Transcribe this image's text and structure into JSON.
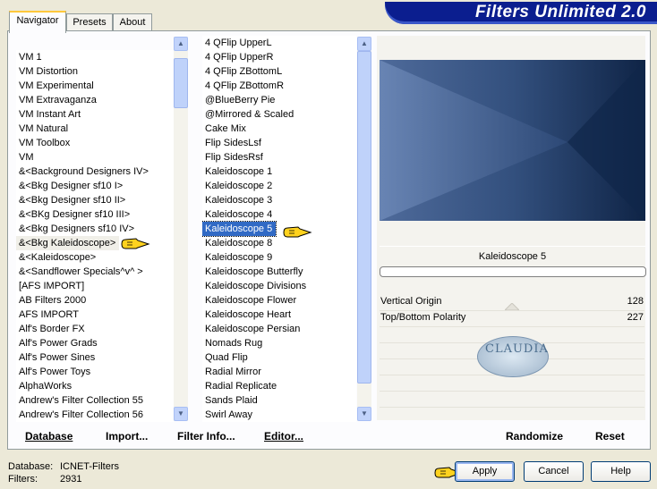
{
  "window": {
    "title": "Filters Unlimited 2.0"
  },
  "tabs": [
    {
      "label": "Navigator"
    },
    {
      "label": "Presets"
    },
    {
      "label": "About"
    }
  ],
  "categories": {
    "items": [
      "VM 1",
      "VM Distortion",
      "VM Experimental",
      "VM Extravaganza",
      "VM Instant Art",
      "VM Natural",
      "VM Toolbox",
      "VM",
      "&<Background Designers IV>",
      "&<Bkg Designer sf10 I>",
      "&<Bkg Designer sf10 II>",
      "&<BKg Designer sf10 III>",
      "&<Bkg Designers sf10 IV>",
      "&<Bkg Kaleidoscope>",
      "&<Kaleidoscope>",
      "&<Sandflower Specials^v^ >",
      "[AFS IMPORT]",
      "AB Filters 2000",
      "AFS IMPORT",
      "Alf's Border FX",
      "Alf's Power Grads",
      "Alf's Power Sines",
      "Alf's Power Toys",
      "AlphaWorks",
      "Andrew's Filter Collection 55",
      "Andrew's Filter Collection 56"
    ],
    "selected": "&<Bkg Kaleidoscope>"
  },
  "filters": {
    "items": [
      "4 QFlip UpperL",
      "4 QFlip UpperR",
      "4 QFlip ZBottomL",
      "4 QFlip ZBottomR",
      "@BlueBerry Pie",
      "@Mirrored & Scaled",
      "Cake Mix",
      "Flip SidesLsf",
      "Flip SidesRsf",
      "Kaleidoscope 1",
      "Kaleidoscope 2",
      "Kaleidoscope 3",
      "Kaleidoscope 4",
      "Kaleidoscope 5",
      "Kaleidoscope 8",
      "Kaleidoscope 9",
      "Kaleidoscope Butterfly",
      "Kaleidoscope Divisions",
      "Kaleidoscope Flower",
      "Kaleidoscope Heart",
      "Kaleidoscope Persian",
      "Nomads Rug",
      "Quad Flip",
      "Radial Mirror",
      "Radial Replicate",
      "Sands Plaid",
      "Swirl Away"
    ],
    "selected": "Kaleidoscope 5"
  },
  "preview": {
    "filter_name": "Kaleidoscope 5",
    "watermark": "CLAUDIA"
  },
  "parameters": [
    {
      "label": "Vertical Origin",
      "value": "128"
    },
    {
      "label": "Top/Bottom Polarity",
      "value": "227"
    }
  ],
  "bottom_links": {
    "database": "Database",
    "import": "Import...",
    "filter_info": "Filter Info...",
    "editor": "Editor...",
    "randomize": "Randomize",
    "reset": "Reset"
  },
  "status": {
    "database_label": "Database:",
    "database_value": "ICNET-Filters",
    "filters_label": "Filters:",
    "filters_value": "2931"
  },
  "buttons": {
    "apply": "Apply",
    "cancel": "Cancel",
    "help": "Help"
  },
  "colors": {
    "selection": "#316AC5",
    "banner": "#0B1E8F",
    "preview_dark": "#132A4E",
    "preview_light": "#5F7DAE"
  }
}
